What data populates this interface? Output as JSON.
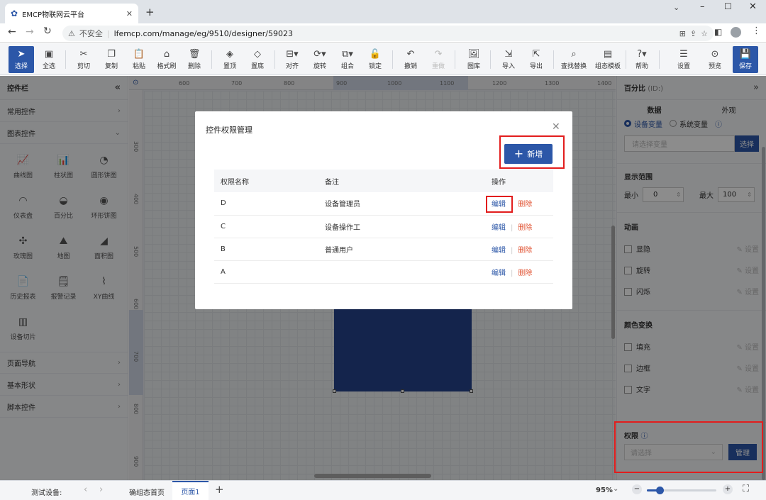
{
  "browser": {
    "tab_title": "EMCP物联网云平台",
    "not_secure": "不安全",
    "url": "lfemcp.com/manage/eg/9510/designer/59023"
  },
  "toolbar": {
    "items": [
      {
        "label": "选择",
        "icon": "pointer-icon"
      },
      {
        "label": "全选",
        "icon": "select-all-icon"
      },
      {
        "label": "剪切",
        "icon": "cut-icon"
      },
      {
        "label": "复制",
        "icon": "copy-icon"
      },
      {
        "label": "粘贴",
        "icon": "paste-icon"
      },
      {
        "label": "格式刷",
        "icon": "format-brush-icon"
      },
      {
        "label": "删除",
        "icon": "trash-icon"
      },
      {
        "label": "置顶",
        "icon": "bring-front-icon"
      },
      {
        "label": "置底",
        "icon": "send-back-icon"
      },
      {
        "label": "对齐",
        "icon": "align-icon"
      },
      {
        "label": "旋转",
        "icon": "rotate-icon"
      },
      {
        "label": "组合",
        "icon": "group-icon"
      },
      {
        "label": "锁定",
        "icon": "lock-icon"
      },
      {
        "label": "撤销",
        "icon": "undo-icon"
      },
      {
        "label": "重做",
        "icon": "redo-icon"
      },
      {
        "label": "图库",
        "icon": "gallery-icon"
      },
      {
        "label": "导入",
        "icon": "import-icon"
      },
      {
        "label": "导出",
        "icon": "export-icon"
      },
      {
        "label": "查找替换",
        "icon": "find-replace-icon"
      },
      {
        "label": "组态模板",
        "icon": "template-icon"
      },
      {
        "label": "帮助",
        "icon": "help-icon"
      },
      {
        "label": "设置",
        "icon": "settings-icon"
      },
      {
        "label": "预览",
        "icon": "preview-icon"
      },
      {
        "label": "保存",
        "icon": "save-icon"
      }
    ]
  },
  "left_panel": {
    "title": "控件栏",
    "categories_top": [
      {
        "label": "常用控件"
      },
      {
        "label": "图表控件"
      }
    ],
    "chart_items": [
      {
        "label": "曲线图",
        "icon": "line-chart-icon"
      },
      {
        "label": "柱状图",
        "icon": "bar-chart-icon"
      },
      {
        "label": "圆形饼图",
        "icon": "pie-chart-icon"
      },
      {
        "label": "仪表盘",
        "icon": "gauge-icon"
      },
      {
        "label": "百分比",
        "icon": "percent-icon"
      },
      {
        "label": "环形饼图",
        "icon": "donut-icon"
      },
      {
        "label": "玫瑰图",
        "icon": "rose-chart-icon"
      },
      {
        "label": "地图",
        "icon": "map-icon"
      },
      {
        "label": "面积图",
        "icon": "area-chart-icon"
      },
      {
        "label": "历史报表",
        "icon": "report-icon"
      },
      {
        "label": "报警记录",
        "icon": "alarm-record-icon"
      },
      {
        "label": "XY曲线",
        "icon": "xy-curve-icon"
      },
      {
        "label": "设备切片",
        "icon": "device-slice-icon"
      }
    ],
    "categories_bottom": [
      {
        "label": "页面导航"
      },
      {
        "label": "基本形状"
      },
      {
        "label": "脚本控件"
      }
    ]
  },
  "ruler": {
    "top": [
      "600",
      "700",
      "800",
      "900",
      "1000",
      "1100",
      "1200",
      "1300",
      "1400"
    ],
    "left": [
      "300",
      "400",
      "500",
      "600",
      "700",
      "800",
      "900"
    ]
  },
  "right_panel": {
    "title": "百分比",
    "title_id": "(ID:)",
    "tabs": [
      "数据",
      "外观"
    ],
    "radio_device_var": "设备变量",
    "radio_system_var": "系统变量",
    "var_placeholder": "请选择变量",
    "select_button": "选择",
    "range_title": "显示范围",
    "min_label": "最小",
    "min_value": "0",
    "max_label": "最大",
    "max_value": "100",
    "anim_title": "动画",
    "anim_items": [
      "显隐",
      "旋转",
      "闪烁"
    ],
    "setting_label": "设置",
    "color_title": "颜色变换",
    "color_items": [
      "填充",
      "边框",
      "文字"
    ],
    "perm_title": "权限",
    "perm_placeholder": "请选择",
    "manage_button": "管理"
  },
  "bottom_bar": {
    "test_device": "测试设备:",
    "home_tab": "确组态首页",
    "page_tab": "页面1",
    "zoom": "95%"
  },
  "modal": {
    "title": "控件权限管理",
    "add_button": "新增",
    "columns": [
      "权限名称",
      "备注",
      "操作"
    ],
    "rows": [
      {
        "name": "D",
        "note": "设备管理员"
      },
      {
        "name": "C",
        "note": "设备操作工"
      },
      {
        "name": "B",
        "note": "普通用户"
      },
      {
        "name": "A",
        "note": ""
      }
    ],
    "edit_label": "编辑",
    "delete_label": "删除"
  },
  "colors": {
    "primary": "#2c57a8",
    "danger": "#e0502f",
    "highlight": "#e21d1d",
    "shape_fill": "#25428a"
  }
}
